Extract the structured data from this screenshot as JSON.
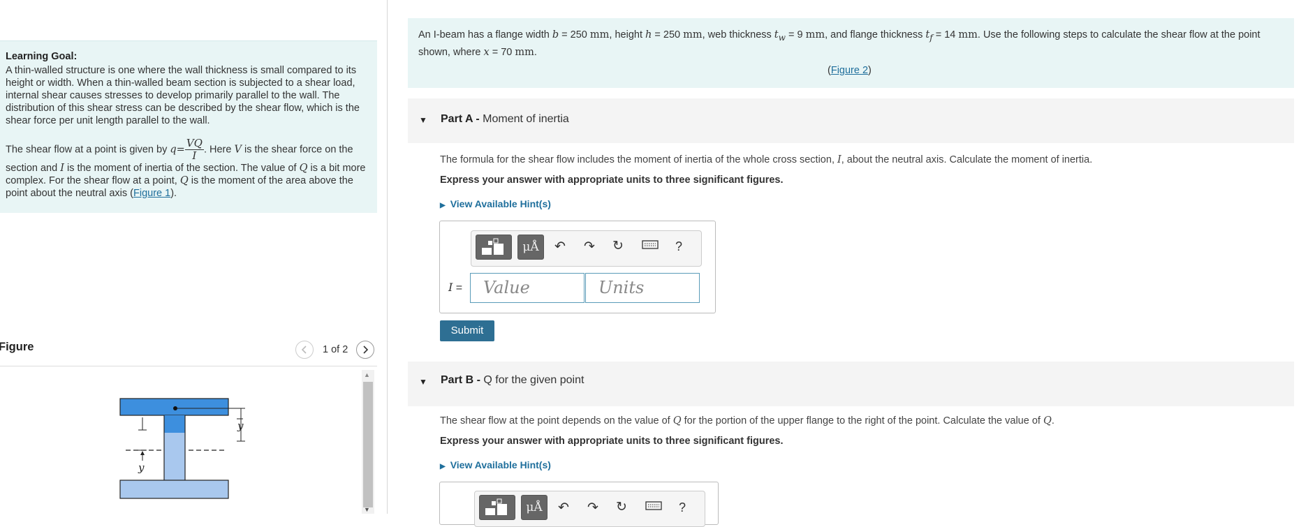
{
  "learning_goal": {
    "title": "Learning Goal:",
    "text": "A thin-walled structure is one where the wall thickness is small compared to its height or width. When a thin-walled beam section is subjected to a shear load, internal shear causes stresses to develop primarily parallel to the wall. The distribution of this shear stress can be described by the shear flow, which is the shear force per unit length parallel to the wall.",
    "flow_p1": "The shear flow at a point is given by",
    "flow_q": "q",
    "flow_eq": "=",
    "flow_num": "VQ",
    "flow_den": "I",
    "flow_p2": ". Here",
    "flow_V": "V",
    "flow_p3": "is the shear force on the section and",
    "flow_I": "I",
    "flow_p4": "is the moment of inertia of the section. The value of",
    "flow_Q": "Q",
    "flow_p5": "is a bit more complex. For the shear flow at a point,",
    "flow_Q2": "Q",
    "flow_p6": "is the moment of the area above the point about the neutral axis (",
    "figure1_link": "Figure 1",
    "flow_p7": ")."
  },
  "figure_panel": {
    "title": "Figure",
    "pager": "1 of 2",
    "prev_icon": "chevron-left-icon",
    "next_icon": "chevron-right-icon",
    "label_top": "y",
    "label_bottom": "y"
  },
  "problem": {
    "t1": "An I-beam has a flange width",
    "b": "b",
    "t2": "= 250",
    "u1": "mm",
    "t3": ", height",
    "h": "h",
    "t4": "= 250",
    "u2": "mm",
    "t5": ", web thickness",
    "tw": "t",
    "tw_sub": "w",
    "t6": "= 9",
    "u3": "mm",
    "t7": ", and flange thickness",
    "tf": "t",
    "tf_sub": "f",
    "t8": "= 14",
    "u4": "mm",
    "t9": ". Use the following steps to calculate the shear flow at the point shown, where",
    "x": "x",
    "t10": "= 70",
    "u5": "mm",
    "t11": ".",
    "figure2_open": "(",
    "figure2_link": "Figure 2",
    "figure2_close": ")"
  },
  "part_a": {
    "label": "Part A -",
    "title": "Moment of inertia",
    "q1": "The formula for the shear flow includes the moment of inertia of the whole cross section,",
    "q_I": "I",
    "q2": ", about the neutral axis. Calculate the moment of inertia.",
    "instruction": "Express your answer with appropriate units to three significant figures.",
    "hint": "View Available Hint(s)",
    "var_label": "I",
    "var_eq": "=",
    "value_placeholder": "Value",
    "units_placeholder": "Units",
    "mu_label": "μÅ",
    "help_label": "?",
    "submit": "Submit"
  },
  "part_b": {
    "label": "Part B -",
    "title": "Q for the given point",
    "q1": "The shear flow at the point depends on the value of",
    "q_Q": "Q",
    "q2": "for the portion of the upper flange to the right of the point. Calculate the value of",
    "q_Q2": "Q",
    "q3": ".",
    "instruction": "Express your answer with appropriate units to three significant figures.",
    "hint": "View Available Hint(s)",
    "mu_label": "μÅ",
    "help_label": "?"
  },
  "colors": {
    "panel_bg": "#e8f5f5",
    "link": "#1f6f9c",
    "submit_bg": "#2e6f93",
    "flange_dark": "#3d8fde",
    "flange_light": "#a9c8ee"
  }
}
